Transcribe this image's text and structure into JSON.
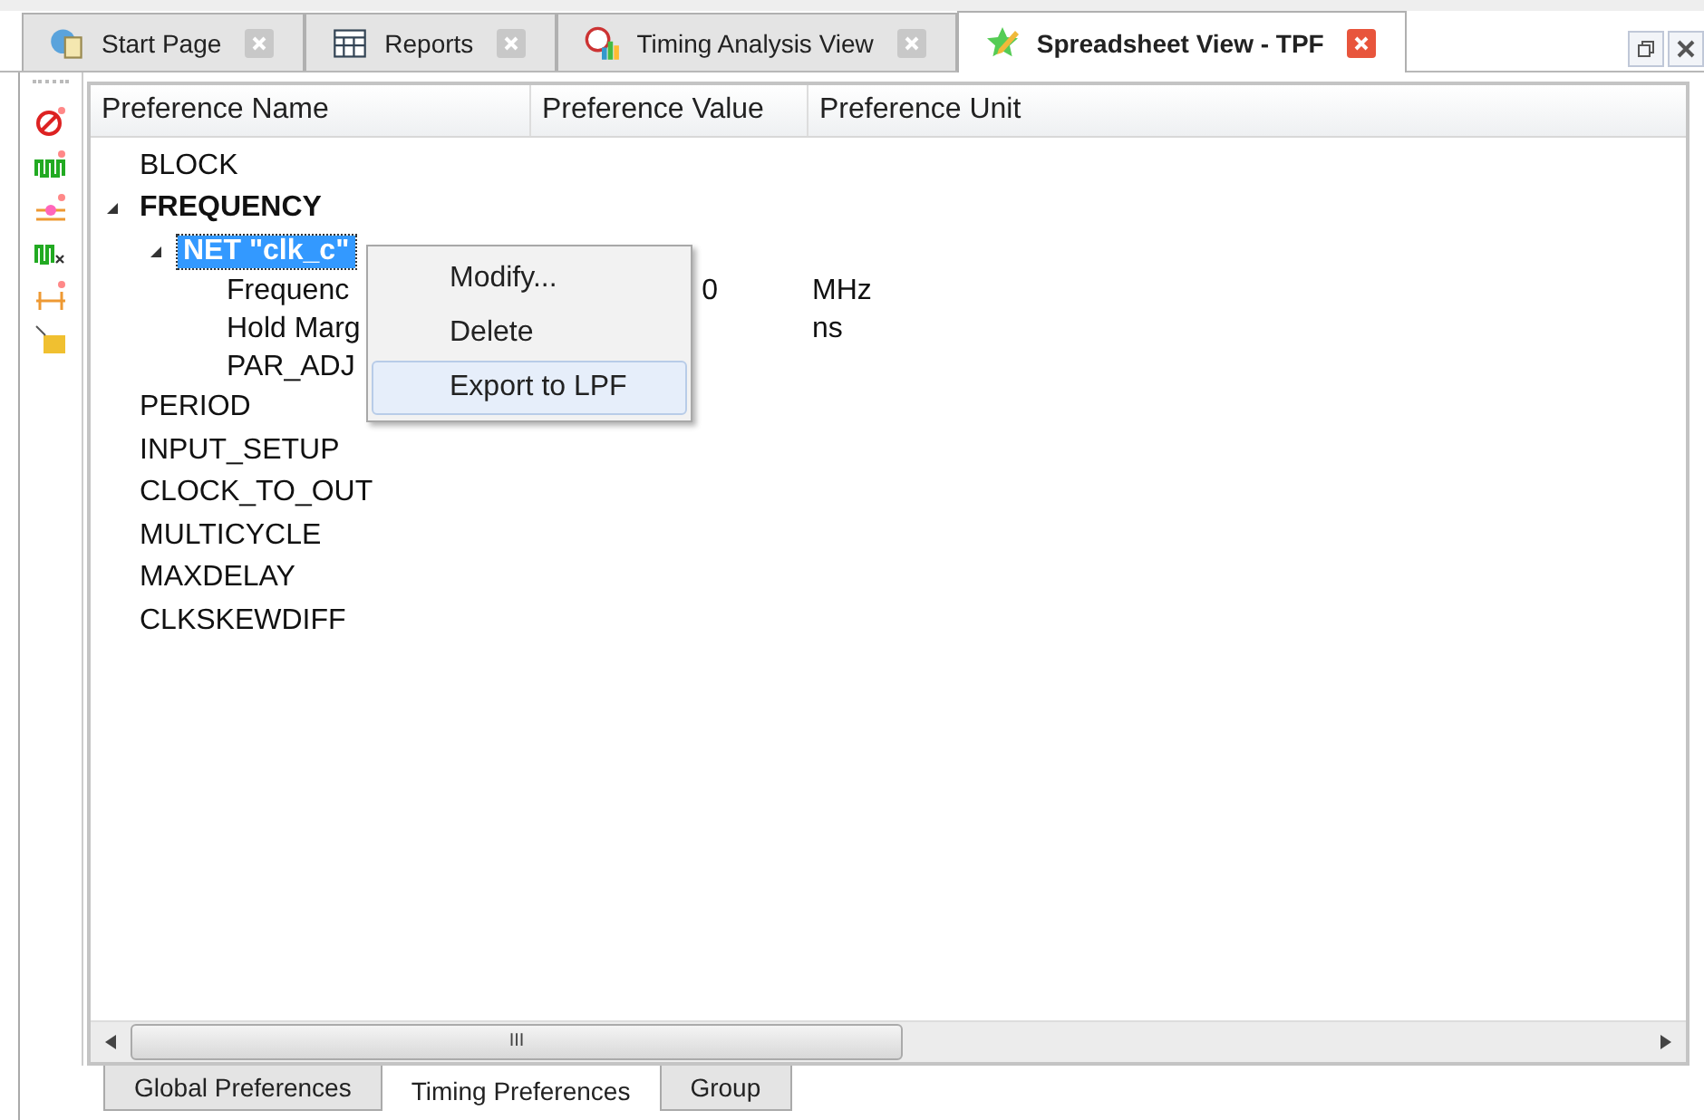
{
  "tabs": [
    {
      "label": "Start Page",
      "kind": "start",
      "selected": false
    },
    {
      "label": "Reports",
      "kind": "reports",
      "selected": false
    },
    {
      "label": "Timing Analysis View",
      "kind": "timing",
      "selected": false
    },
    {
      "label": "Spreadsheet View - TPF",
      "kind": "spreadsheet",
      "selected": true
    }
  ],
  "table": {
    "columns": [
      "Preference Name",
      "Preference Value",
      "Preference Unit"
    ],
    "rows": [
      {
        "name": "BLOCK",
        "bold": false,
        "selected": false
      },
      {
        "name": "FREQUENCY",
        "bold": true,
        "selected": false,
        "expanded": true,
        "children": [
          {
            "name": "NET \"clk_c\"",
            "bold": true,
            "selected": true,
            "expanded": true,
            "children": [
              {
                "name": "Frequenc",
                "value": "0",
                "unit": "MHz",
                "bold": false,
                "selected": false
              },
              {
                "name": "Hold Marg",
                "unit": "ns",
                "bold": false,
                "selected": false
              },
              {
                "name": "PAR_ADJ",
                "bold": false,
                "selected": false
              }
            ]
          }
        ]
      },
      {
        "name": "PERIOD",
        "bold": false,
        "selected": false
      },
      {
        "name": "INPUT_SETUP",
        "bold": false,
        "selected": false
      },
      {
        "name": "CLOCK_TO_OUT",
        "bold": false,
        "selected": false
      },
      {
        "name": "MULTICYCLE",
        "bold": false,
        "selected": false
      },
      {
        "name": "MAXDELAY",
        "bold": false,
        "selected": false
      },
      {
        "name": "CLKSKEWDIFF",
        "bold": false,
        "selected": false
      }
    ]
  },
  "context_menu": [
    {
      "label": "Modify...",
      "selected": false
    },
    {
      "label": "Delete",
      "selected": false
    },
    {
      "label": "Export to LPF",
      "selected": true
    }
  ],
  "scrollbar_text": "III",
  "bottom_tabs": [
    {
      "label": "Global Preferences",
      "selected": false
    },
    {
      "label": "Timing Preferences",
      "selected": true
    },
    {
      "label": "Group",
      "selected": false
    }
  ]
}
